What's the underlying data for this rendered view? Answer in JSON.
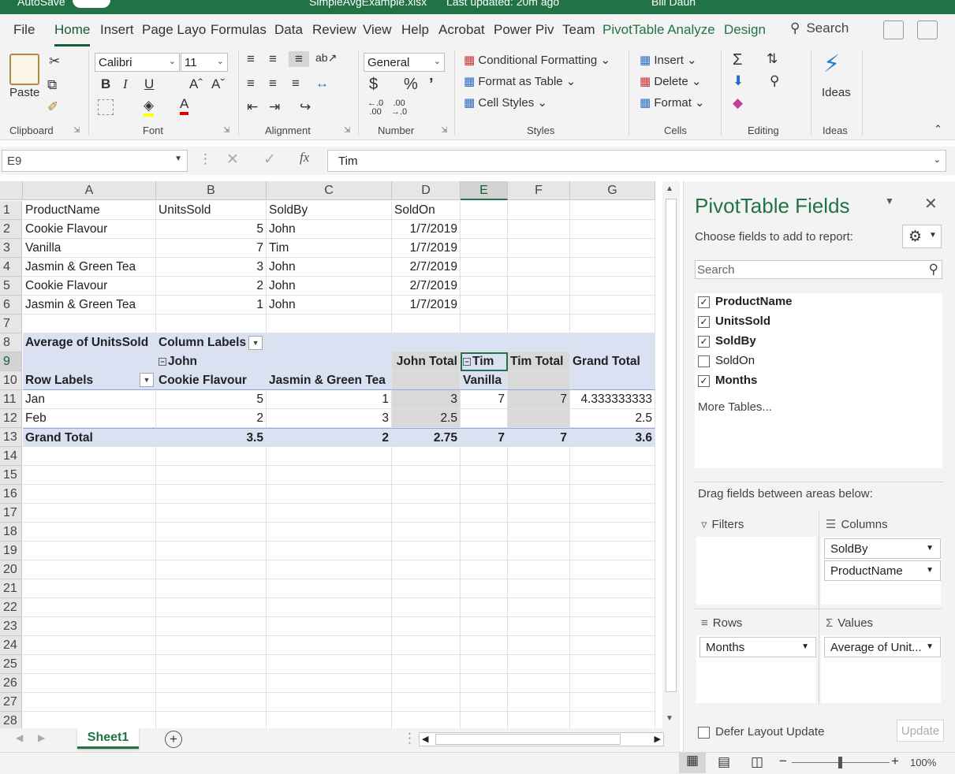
{
  "title": {
    "autosave": "AutoSave",
    "autosave_state": "Off",
    "filename": "SimpleAvgExample.xlsx",
    "updated": "Last updated: 20m ago",
    "user": "Bill Daun"
  },
  "tabs": [
    "File",
    "Home",
    "Insert",
    "Page Layo",
    "Formulas",
    "Data",
    "Review",
    "View",
    "Help",
    "Acrobat",
    "Power Piv",
    "Team",
    "PivotTable Analyze",
    "Design"
  ],
  "tab_search": "Search",
  "ribbon": {
    "clipboard": {
      "paste": "Paste",
      "label": "Clipboard"
    },
    "font": {
      "name": "Calibri",
      "size": "11",
      "label": "Font"
    },
    "alignment": {
      "label": "Alignment"
    },
    "number": {
      "format": "General",
      "label": "Number"
    },
    "styles": {
      "conditional": "Conditional Formatting",
      "format_table": "Format as Table",
      "cell_styles": "Cell Styles",
      "label": "Styles"
    },
    "cells": {
      "insert": "Insert",
      "delete": "Delete",
      "format": "Format",
      "label": "Cells"
    },
    "editing": {
      "label": "Editing"
    },
    "ideas": {
      "button": "Ideas",
      "label": "Ideas"
    }
  },
  "formula_bar": {
    "name_box": "E9",
    "fx": "fx",
    "value": "Tim"
  },
  "sheet": {
    "columns": [
      "A",
      "B",
      "C",
      "D",
      "E",
      "F",
      "G"
    ],
    "rows": [
      "1",
      "2",
      "3",
      "4",
      "5",
      "6",
      "7",
      "8",
      "9",
      "10",
      "11",
      "12",
      "13",
      "14",
      "15",
      "16",
      "17",
      "18",
      "19",
      "20",
      "21",
      "22",
      "23",
      "24",
      "25",
      "26",
      "27",
      "28"
    ],
    "data": [
      [
        "ProductName",
        "UnitsSold",
        "SoldBy",
        "SoldOn"
      ],
      [
        "Cookie Flavour",
        "5",
        "John",
        "1/7/2019"
      ],
      [
        "Vanilla",
        "7",
        "Tim",
        "1/7/2019"
      ],
      [
        "Jasmin & Green Tea",
        "3",
        "John",
        "2/7/2019"
      ],
      [
        "Cookie Flavour",
        "2",
        "John",
        "2/7/2019"
      ],
      [
        "Jasmin & Green Tea",
        "1",
        "John",
        "1/7/2019"
      ]
    ],
    "pivot": {
      "title": "Average of UnitsSold",
      "column_labels": "Column Labels",
      "row_labels": "Row Labels",
      "john": "John",
      "john_total": "John Total",
      "tim": "Tim",
      "tim_total": "Tim Total",
      "grand_total": "Grand Total",
      "cookie": "Cookie Flavour",
      "jasmin": "Jasmin & Green Tea",
      "vanilla": "Vanilla",
      "jan": {
        "label": "Jan",
        "cookie": "5",
        "jasmin": "1",
        "john_total": "3",
        "vanilla": "7",
        "tim_total": "7",
        "grand": "4.333333333"
      },
      "feb": {
        "label": "Feb",
        "cookie": "2",
        "jasmin": "3",
        "john_total": "2.5",
        "vanilla": "",
        "tim_total": "",
        "grand": "2.5"
      },
      "total": {
        "label": "Grand Total",
        "cookie": "3.5",
        "jasmin": "2",
        "john_total": "2.75",
        "vanilla": "7",
        "tim_total": "7",
        "grand": "3.6"
      }
    }
  },
  "sheet_tab": "Sheet1",
  "pane": {
    "title": "PivotTable Fields",
    "subtitle": "Choose fields to add to report:",
    "search_placeholder": "Search",
    "fields": [
      {
        "name": "ProductName",
        "checked": true
      },
      {
        "name": "UnitsSold",
        "checked": true
      },
      {
        "name": "SoldBy",
        "checked": true
      },
      {
        "name": "SoldOn",
        "checked": false
      },
      {
        "name": "Months",
        "checked": true
      }
    ],
    "more_tables": "More Tables...",
    "drag_hint": "Drag fields between areas below:",
    "filters": "Filters",
    "columns": "Columns",
    "rows": "Rows",
    "values": "Values",
    "columns_items": [
      "SoldBy",
      "ProductName"
    ],
    "rows_items": [
      "Months"
    ],
    "values_items": [
      "Average of Unit..."
    ],
    "defer": "Defer Layout Update",
    "update": "Update"
  },
  "status": {
    "zoom": "100%"
  },
  "colors": {
    "accent": "#217346",
    "pivot_blue": "#d9e1f2",
    "pivot_gray": "#d9d9d9"
  }
}
